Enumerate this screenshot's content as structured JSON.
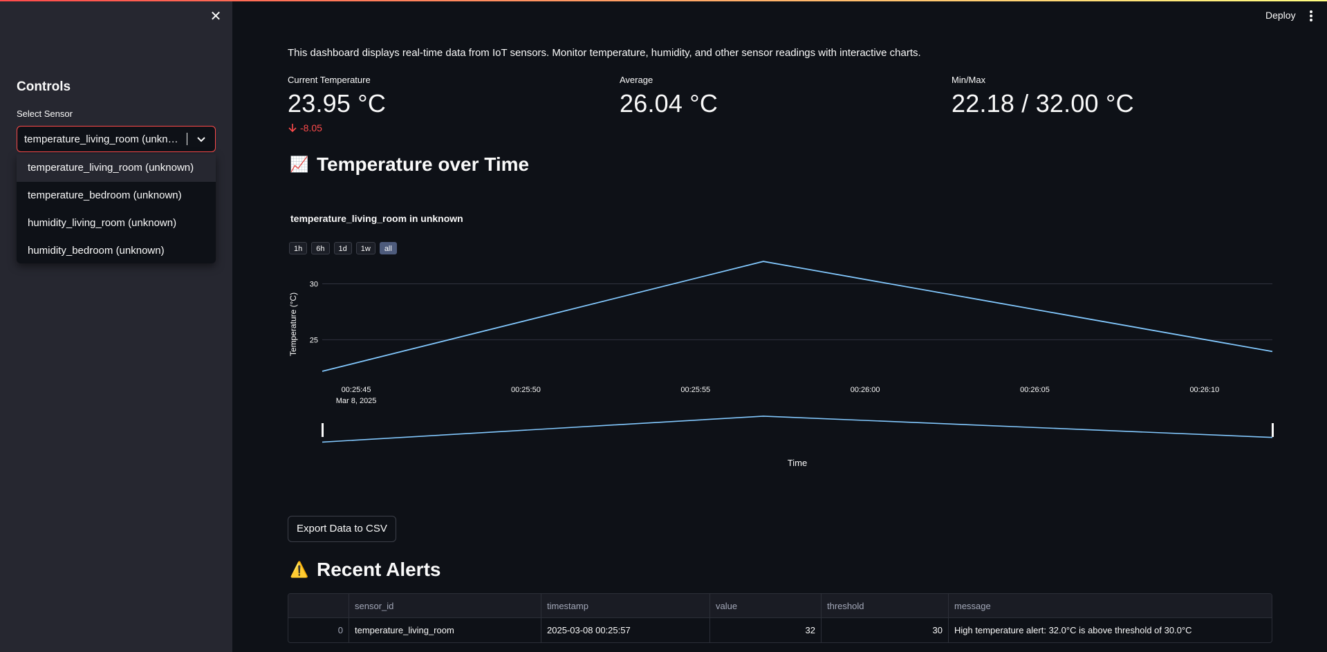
{
  "sidebar": {
    "title": "Controls",
    "select_label": "Select Sensor",
    "select_value": "temperature_living_room (unkn…",
    "options": [
      "temperature_living_room (unknown)",
      "temperature_bedroom (unknown)",
      "humidity_living_room (unknown)",
      "humidity_bedroom (unknown)"
    ]
  },
  "header": {
    "deploy_label": "Deploy"
  },
  "main": {
    "description": "This dashboard displays real-time data from IoT sensors. Monitor temperature, humidity, and other sensor readings with interactive charts.",
    "metrics": [
      {
        "label": "Current Temperature",
        "value": "23.95 °C",
        "delta": "-8.05"
      },
      {
        "label": "Average",
        "value": "26.04 °C"
      },
      {
        "label": "Min/Max",
        "value": "22.18 / 32.00 °C"
      }
    ],
    "chart_section": {
      "emoji": "📈",
      "title": "Temperature over Time"
    },
    "range_buttons": [
      "1h",
      "6h",
      "1d",
      "1w",
      "all"
    ],
    "selected_range": "all",
    "export_label": "Export Data to CSV",
    "alerts_section": {
      "emoji": "⚠️",
      "title": "Recent Alerts"
    },
    "alerts_table": {
      "columns": [
        "",
        "sensor_id",
        "timestamp",
        "value",
        "threshold",
        "message"
      ],
      "rows": [
        [
          "0",
          "temperature_living_room",
          "2025-03-08 00:25:57",
          "32",
          "30",
          "High temperature alert: 32.0°C is above threshold of 30.0°C"
        ]
      ]
    }
  },
  "chart_data": {
    "type": "line",
    "title": "temperature_living_room in unknown",
    "xlabel": "Time",
    "ylabel": "Temperature (°C)",
    "x": [
      "2025-03-08 00:25:44",
      "2025-03-08 00:25:57",
      "2025-03-08 00:26:12"
    ],
    "series": [
      {
        "values": [
          22.18,
          32.0,
          23.95
        ]
      }
    ],
    "x_ticks": [
      "00:25:45",
      "00:25:50",
      "00:25:55",
      "00:26:00",
      "00:26:05",
      "00:26:10"
    ],
    "x_tick_sublabel": "Mar 8, 2025",
    "y_ticks": [
      25,
      30
    ],
    "ylim": [
      21.5,
      32.5
    ],
    "line_color": "#83c9ff",
    "grid": true,
    "range_slider": true
  }
}
